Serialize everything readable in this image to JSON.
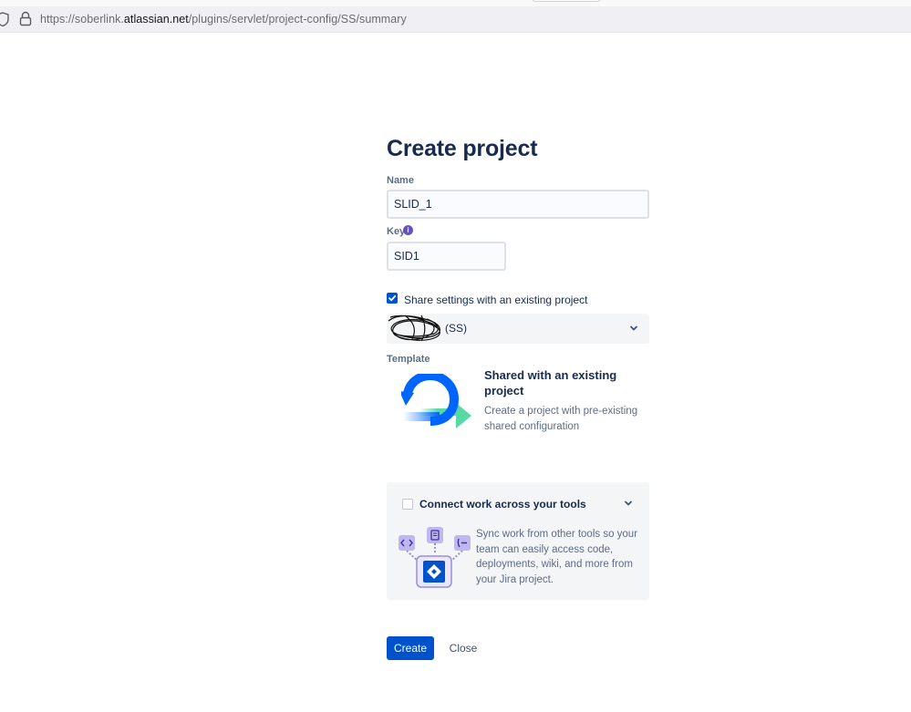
{
  "browser": {
    "url_prefix": "https://soberlink.",
    "url_domain": "atlassian.net",
    "url_path": "/plugins/servlet/project-config/SS/summary"
  },
  "form": {
    "title": "Create project",
    "name_label": "Name",
    "name_value": "SLID_1",
    "key_label": "Key",
    "key_value": "SID1",
    "share_label": "Share settings with an existing project",
    "share_checked": true,
    "project_select_value": "(SS)",
    "template_label": "Template",
    "template_title": "Shared with an existing project",
    "template_desc": "Create a project with pre-existing shared configuration"
  },
  "connect": {
    "title": "Connect work across your tools",
    "checked": false,
    "desc": "Sync work from other tools so your team can easily access code, deployments, wiki, and more from your Jira project."
  },
  "buttons": {
    "create": "Create",
    "close": "Close"
  },
  "colors": {
    "primary": "#0052cc",
    "text": "#172b4d",
    "subtle": "#5e6c84",
    "panel_bg": "#f4f5f7",
    "info": "#6554c0"
  }
}
